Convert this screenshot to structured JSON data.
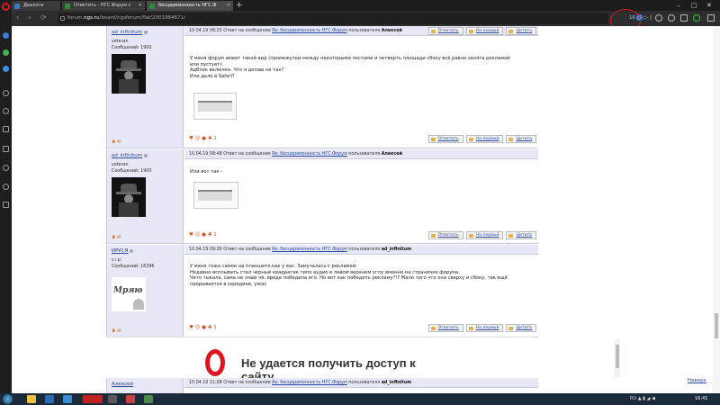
{
  "browser": {
    "tabs": [
      {
        "title": "Диалоги",
        "active": false
      },
      {
        "title": "Ответить - НГС.Форум с",
        "active": false
      },
      {
        "title": "бесцеремонность НГС.Ф",
        "active": true
      }
    ],
    "new_tab": "+",
    "url_prefix": "forum.",
    "url_host": "ngs.ru",
    "url_path": "/board/ngsforum/flat/2001984671/",
    "adblock_count": "16",
    "window_controls": [
      "–",
      "□",
      "✕"
    ]
  },
  "post_buttons": {
    "reply": "Ответить",
    "first": "На первый",
    "quote": "Цитата"
  },
  "posts": [
    {
      "author": "ad_infinitum",
      "rank": "veteran",
      "count": "Сообщений: 1900",
      "date": "10.04.19 08:33",
      "reply_prefix": "Ответ на сообщение",
      "thread": "Re: бесцеремонность НГС.Форум",
      "by": "пользователя",
      "to_user": "Алексей",
      "lines": [
        "У меня форум имеет такой вид (промежутки между некоторыми постами и четверть площади сбоку всё равно занята рекламой",
        "или пустует).",
        "Адблок включен. Что я делаю не так?",
        "Или дело в Safari?"
      ],
      "reacts": "♥ ☺ ● ♣ 1"
    },
    {
      "author": "ad_infinitum",
      "rank": "veteran",
      "count": "Сообщений: 1900",
      "date": "10.04.19 08:48",
      "reply_prefix": "Ответ на сообщение",
      "thread": "Re: бесцеремонность НГС.Форум",
      "by": "пользователя",
      "to_user": "Алексей",
      "lines": [
        "Или вот так -"
      ],
      "reacts": "♥ ☺ ● ♣ 1"
    },
    {
      "author": "ИРУСЯ",
      "rank": "s.i.p.",
      "count": "Сообщений: 16396",
      "avatar_text": "Мряю",
      "date": "10.04.19 09:26",
      "reply_prefix": "Ответ на сообщение",
      "thread": "Re: бесцеремонность НГС.Форум",
      "by": "пользователя",
      "to_user": "ad_infinitum",
      "lines": [
        "У меня тоже самое на планшете,как у вас. Замучалась с рекламой.",
        "Недавно всплывать стал черный квадратик типо аудио в левом верхнем углу именно на страничке форума.",
        "Чето тыкала, сама не знаю чё, вроде победила его. Но вот как победить рекламу?!? Мало того что она сверху и сбоку, так ещё",
        "прорывается в середине, ужас"
      ],
      "reacts": "♥ ☺ ● ♣ 1"
    }
  ],
  "last_post": {
    "author": "Алексей",
    "date": "10.04.19 11:08",
    "reply_prefix": "Ответ на сообщение",
    "thread": "Re: бесцеремонность НГС.Форум",
    "by": "пользователя",
    "to_user": "ad_infinitum"
  },
  "ad": {
    "text_line1": "Не удается получить доступ к",
    "text_line2": "сайту"
  },
  "back_link": "Наверх",
  "taskbar": {
    "lang": "RU",
    "time": "16:41"
  }
}
